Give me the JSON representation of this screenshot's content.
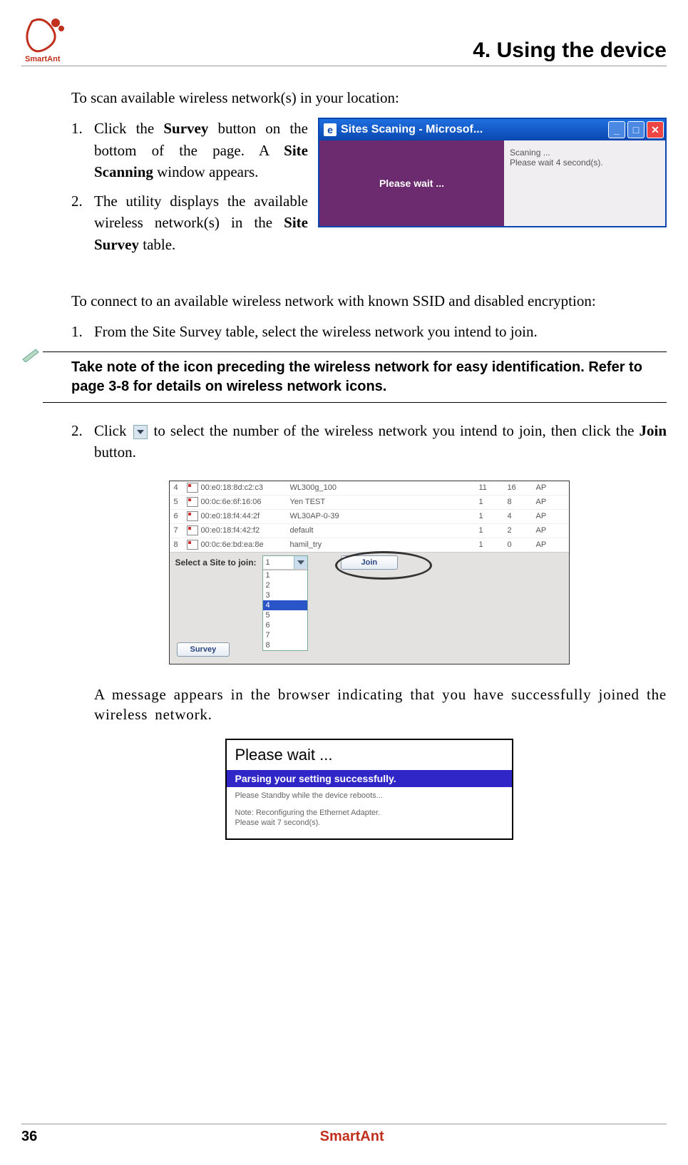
{
  "header": {
    "chapter_title": "4. Using the device",
    "logo_label": "SmartAnt"
  },
  "intro1": "To scan available wireless network(s) in your location:",
  "list1": [
    {
      "num": "1.",
      "pre": "Click the ",
      "b1": "Survey",
      "mid": " button on the bottom of the page. A ",
      "b2": "Site Scanning",
      "post": " window appears."
    },
    {
      "num": "2.",
      "pre": "The utility displays the available wireless network(s)  in the ",
      "b1": "Site Survey",
      "post": " table."
    }
  ],
  "scan_window": {
    "title": "Sites Scaning - Microsof...",
    "left": "Please wait ...",
    "right1": "Scaning ...",
    "right2": "Please wait 4 second(s)."
  },
  "intro2": "To connect to an available wireless network with known SSID and disabled encryption:",
  "list2_item1": {
    "num": "1.",
    "text": "From the Site Survey table, select the wireless network you intend to join."
  },
  "note": "Take note of the icon preceding the wireless network for easy identification. Refer to page 3-8 for details on wireless network icons.",
  "list2_item2": {
    "num": "2.",
    "pre": "Click ",
    "mid": " to select the number of the wireless network you intend to join, then click the ",
    "b1": "Join",
    "post": " button."
  },
  "survey_table": {
    "rows": [
      {
        "idx": "4",
        "mac": "00:e0:18:8d:c2:c3",
        "ssid": "WL300g_100",
        "a": "11",
        "b": "16",
        "type": "AP"
      },
      {
        "idx": "5",
        "mac": "00:0c:6e:6f:16:06",
        "ssid": "Yen TEST",
        "a": "1",
        "b": "8",
        "type": "AP"
      },
      {
        "idx": "6",
        "mac": "00:e0:18:f4:44:2f",
        "ssid": "WL30AP-0-39",
        "a": "1",
        "b": "4",
        "type": "AP"
      },
      {
        "idx": "7",
        "mac": "00:e0:18:f4:42:f2",
        "ssid": "default",
        "a": "1",
        "b": "2",
        "type": "AP"
      },
      {
        "idx": "8",
        "mac": "00:0c:6e:bd:ea:8e",
        "ssid": "hamil_try",
        "a": "1",
        "b": "0",
        "type": "AP"
      }
    ],
    "select_label": "Select a Site to join:",
    "select_value": "1",
    "options": [
      "1",
      "2",
      "3",
      "4",
      "5",
      "6",
      "7",
      "8"
    ],
    "highlight": "4",
    "join_btn": "Join",
    "survey_btn": "Survey"
  },
  "after_table": "A message appears in the browser indicating that you have successfully joined the wireless network.",
  "parse_window": {
    "title": "Please wait ...",
    "bar": "Parsing your setting successfully.",
    "line1": "Please Standby while the device reboots...",
    "line2": "Note: Reconfiguring the Ethernet Adapter.",
    "line3": "Please wait 7 second(s)."
  },
  "footer": {
    "page": "36",
    "brand": "SmartAnt"
  }
}
